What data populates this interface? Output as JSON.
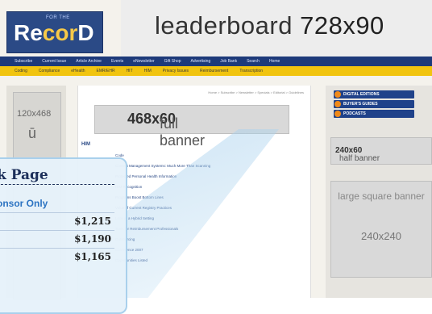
{
  "header": {
    "logo_prefix": "FOR THE",
    "logo_text_a": "Re",
    "logo_text_b": "cor",
    "logo_text_c": "D",
    "leaderboard_label": "leaderboard",
    "leaderboard_size": "728x90"
  },
  "nav_primary": [
    "Subscribe",
    "Current Issue",
    "Article Archive",
    "Events",
    "eNewsletter",
    "Gift Shop",
    "Advertising",
    "Job Bank",
    "Search",
    "Home"
  ],
  "nav_secondary": [
    "Coding",
    "Compliance",
    "eHealth",
    "EMR/EHR",
    "HIT",
    "HIM",
    "Privacy Issues",
    "Reimbursement",
    "Transcription"
  ],
  "left_ad": {
    "size": "120x468",
    "glyph": "ū"
  },
  "content": {
    "breadcrumb": "Home > Subscribe > Newsletter > Specials > Editorial > Guidelines",
    "full_banner_label": "full banner",
    "full_banner_size": "468x60",
    "section_heading": "HIM",
    "links": [
      "Code",
      "Content Management Systems: Much More Than Scanning",
      "Protected Personal Health Information",
      "HIM Recognition",
      "Programs Boost Bottom Lines",
      "Value of Current Registry Practices",
      "Look at a Hybrid Setting",
      "Tools for Reimbursement Professionals",
      "Outsourcing",
      "Conference 2007",
      "Opportunities Listed"
    ]
  },
  "right_column": {
    "links": [
      "DIGITAL EDITIONS",
      "BUYER'S GUIDES",
      "PODCASTS"
    ],
    "half_banner_label": "half banner",
    "half_banner_size": "240x60",
    "square_label": "large square banner",
    "square_size": "240x240"
  },
  "price_card": {
    "title": "k Page",
    "sponsor": "onsor Only",
    "prices": [
      "$1,215",
      "$1,190",
      "$1,165"
    ]
  },
  "colors": {
    "nav_blue": "#1d3a7a",
    "nav_yellow": "#f1c40f",
    "card_border": "#a9d0ec",
    "accent_blue": "#2d74c2"
  }
}
